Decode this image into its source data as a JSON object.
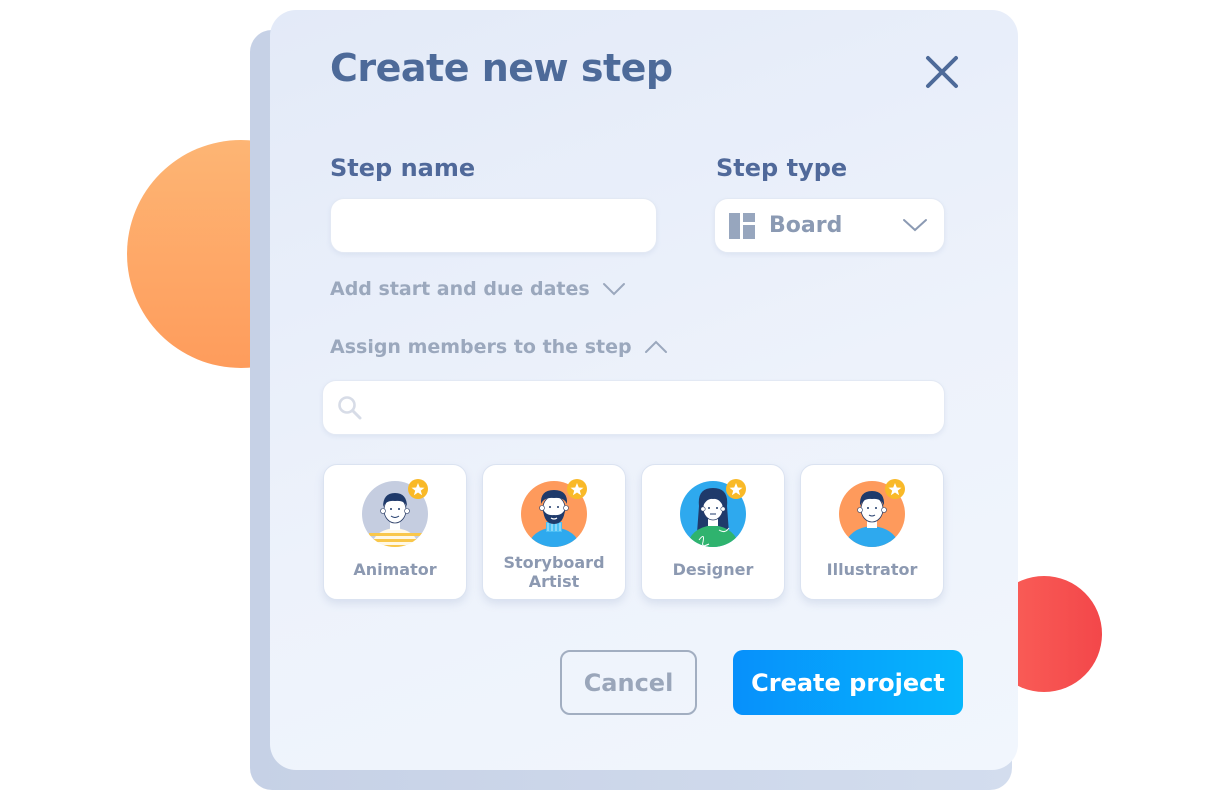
{
  "dialog": {
    "title": "Create new step",
    "close_icon": "close-icon"
  },
  "step_name": {
    "label": "Step name",
    "value": "",
    "placeholder": ""
  },
  "step_type": {
    "label": "Step type",
    "selected": "Board",
    "icon": "board-layout-icon"
  },
  "dates_toggle": {
    "label": "Add start and due dates",
    "state": "collapsed"
  },
  "members_toggle": {
    "label": "Assign members to the step",
    "state": "expanded"
  },
  "member_search": {
    "value": "",
    "placeholder": "",
    "icon": "search-icon"
  },
  "members": [
    {
      "role": "Animator",
      "avatar_bg": "#c5cde0",
      "badge": "star"
    },
    {
      "role": "Storyboard Artist",
      "line1": "Storyboard",
      "line2": "Artist",
      "avatar_bg": "#fe9a5c",
      "badge": "star"
    },
    {
      "role": "Designer",
      "avatar_bg": "#2ea9ee",
      "badge": "star"
    },
    {
      "role": "Illustrator",
      "avatar_bg": "#fe9a5c",
      "badge": "star"
    }
  ],
  "actions": {
    "cancel_label": "Cancel",
    "create_label": "Create project"
  },
  "colors": {
    "primary": "#0790fb",
    "title": "#4d6a99",
    "muted": "#9ba8bd",
    "star_badge": "#f9b928"
  }
}
